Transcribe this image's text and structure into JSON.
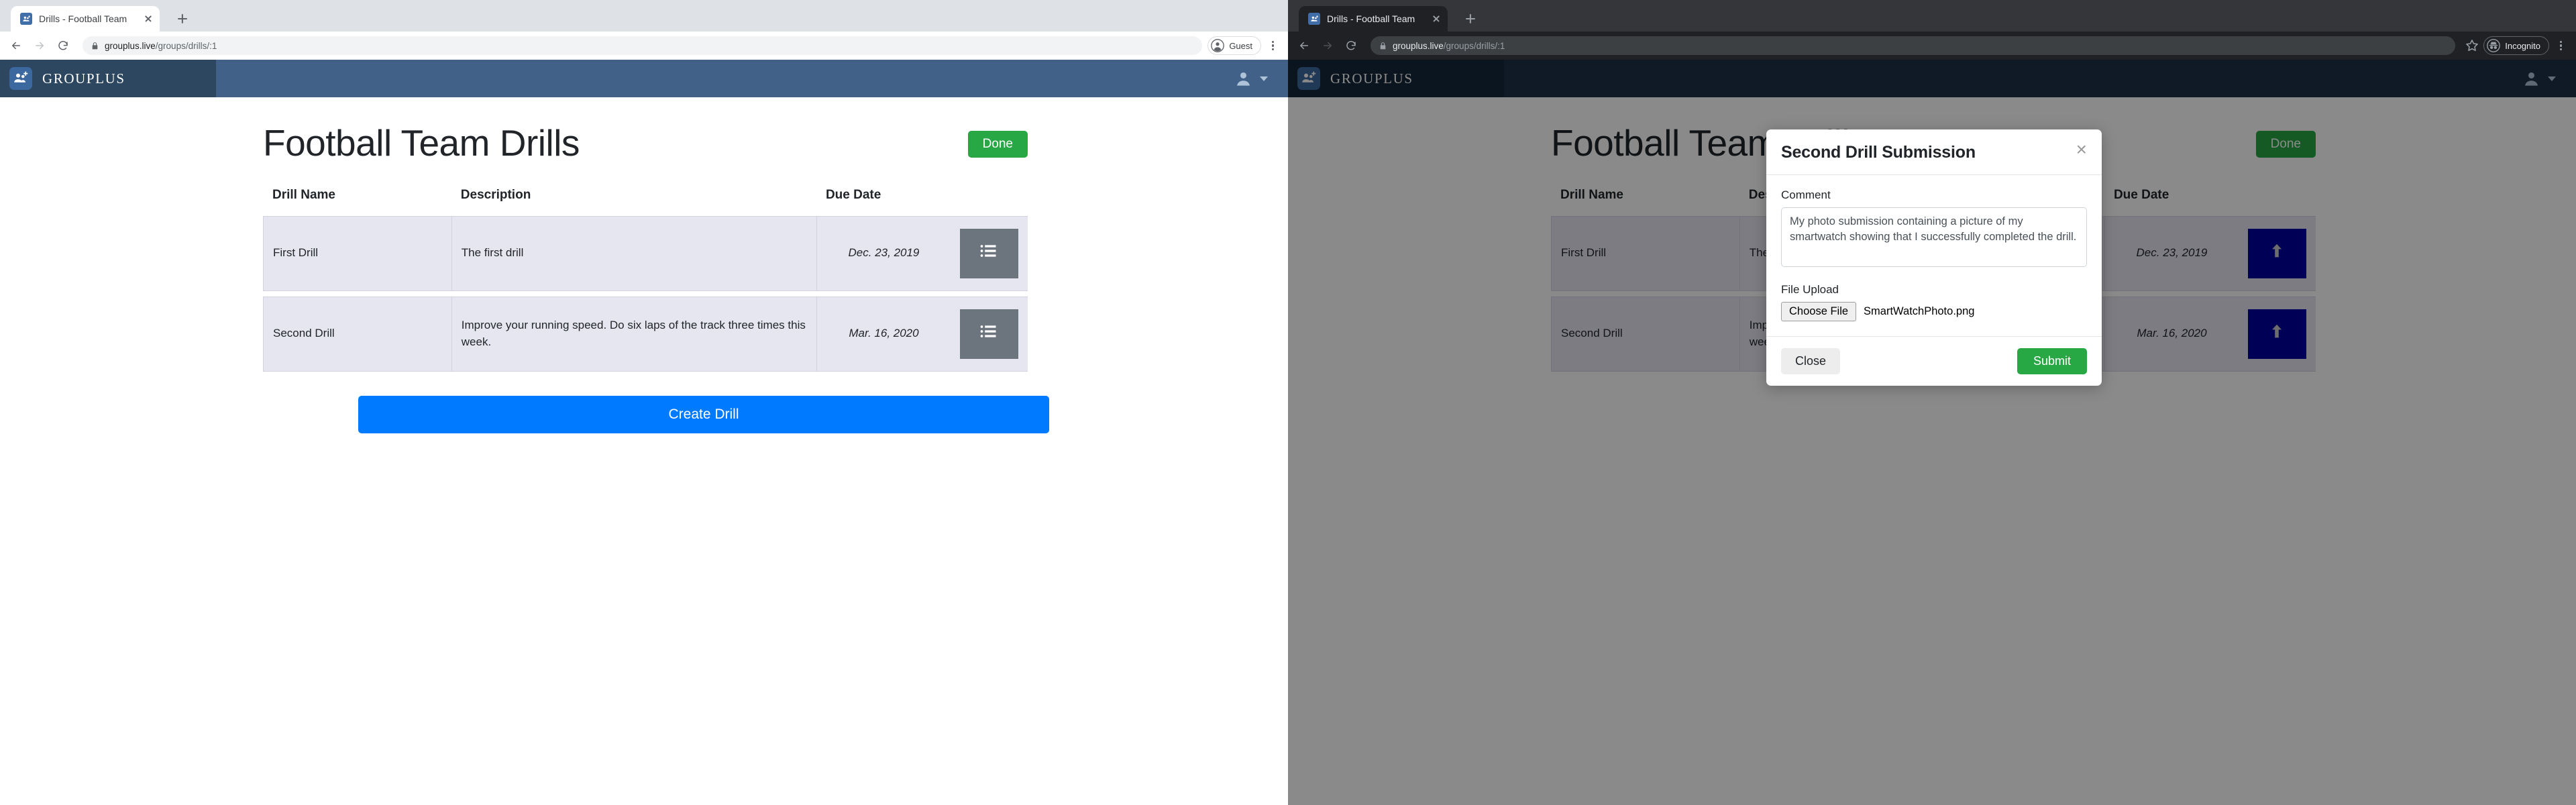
{
  "windows": {
    "left": {
      "browser": {
        "tab_title": "Drills - Football Team",
        "url_domain": "grouplus.live",
        "url_path": "/groups/drills/:1",
        "profile_label": "Guest",
        "icons": {
          "favicon": "grouplus-favicon",
          "tab_close": "close-icon",
          "new_tab": "plus-icon",
          "back": "back-arrow-icon",
          "forward": "forward-arrow-icon",
          "reload": "reload-icon",
          "lock": "lock-icon",
          "profile": "profile-avatar-icon",
          "menu": "kebab-menu-icon"
        }
      },
      "app": {
        "brand": "GROUPLUS",
        "brand_icon": "group-add-icon",
        "user_icon": "user-avatar-icon",
        "user_caret_icon": "chevron-down-icon",
        "page_title": "Football Team Drills",
        "done_label": "Done",
        "create_label": "Create Drill",
        "columns": [
          "Drill Name",
          "Description",
          "Due Date"
        ],
        "action_icon": "list-icon",
        "rows": [
          {
            "name": "First Drill",
            "description": "The first drill",
            "due_date": "Dec. 23, 2019"
          },
          {
            "name": "Second Drill",
            "description": "Improve your running speed. Do six laps of the track three times this week.",
            "due_date": "Mar. 16, 2020"
          }
        ]
      }
    },
    "right": {
      "browser": {
        "tab_title": "Drills - Football Team",
        "url_domain": "grouplus.live",
        "url_path": "/groups/drills/:1",
        "profile_label": "Incognito",
        "icons": {
          "favicon": "grouplus-favicon",
          "tab_close": "close-icon",
          "new_tab": "plus-icon",
          "back": "back-arrow-icon",
          "forward": "forward-arrow-icon",
          "reload": "reload-icon",
          "lock": "lock-icon",
          "bookmark": "star-icon",
          "profile": "incognito-icon",
          "menu": "kebab-menu-icon"
        }
      },
      "app": {
        "brand": "GROUPLUS",
        "brand_icon": "group-add-icon",
        "user_icon": "user-avatar-icon",
        "user_caret_icon": "chevron-down-icon",
        "page_title": "Football Team Drills",
        "done_label": "Done",
        "columns": [
          "Drill Name",
          "Description",
          "Due Date"
        ],
        "action_icon": "upload-arrow-icon",
        "rows": [
          {
            "name": "First Drill",
            "description": "The first drill",
            "due_date": "Dec. 23, 2019"
          },
          {
            "name": "Second Drill",
            "description": "Improve your running speed. Do six laps of the track three times this week.",
            "due_date": "Mar. 16, 2020"
          }
        ]
      },
      "modal": {
        "title": "Second Drill Submission",
        "close_icon": "close-icon",
        "comment_label": "Comment",
        "comment_value": "My photo submission containing a picture of my smartwatch showing that I successfully completed the drill.",
        "upload_label": "File Upload",
        "choose_file_label": "Choose File",
        "file_name": "SmartWatchPhoto.png",
        "close_label": "Close",
        "submit_label": "Submit"
      }
    }
  },
  "colors": {
    "brand_navbar": "#416189",
    "brand_navbar_dark": "#2d4760",
    "done_green": "#28a745",
    "create_blue": "#007bff",
    "action_gray": "#6c757d",
    "upload_blue": "#0000a0",
    "row_bg": "#e6e6f0"
  }
}
